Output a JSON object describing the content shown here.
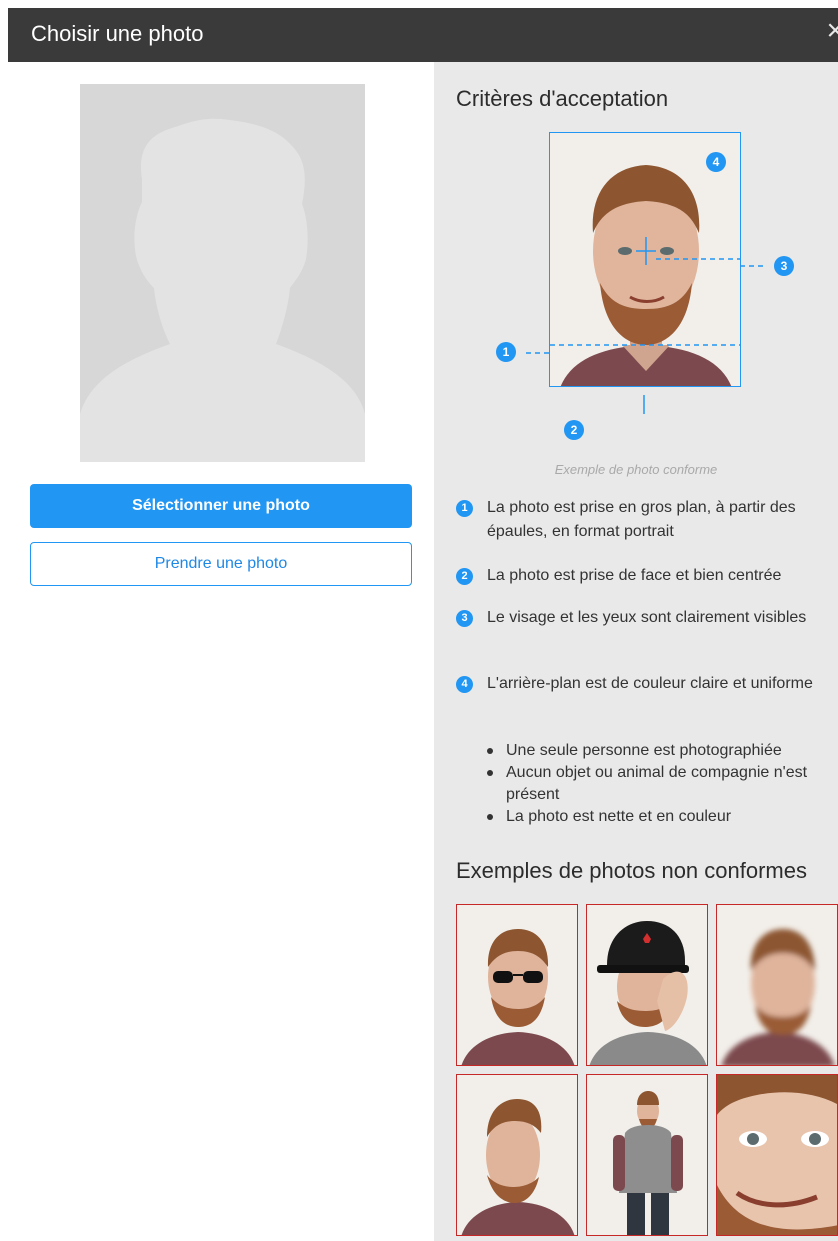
{
  "dialog": {
    "title": "Choisir une photo",
    "close_symbol": "×"
  },
  "left": {
    "avatar_icon": "person-silhouette-icon",
    "select_button": "Sélectionner une photo",
    "take_button": "Prendre une photo"
  },
  "right": {
    "heading": "Critères d'acceptation",
    "markers": [
      "1",
      "2",
      "3",
      "4"
    ],
    "caption": "Exemple de photo conforme",
    "criteria": [
      {
        "num": "1",
        "text": "La photo est prise en gros plan, à partir des épaules, en format portrait"
      },
      {
        "num": "2",
        "text": "La photo est prise de face et bien centrée"
      },
      {
        "num": "3",
        "text": "Le visage et les yeux sont clairement visibles"
      },
      {
        "num": "4",
        "text": "L'arrière-plan est de couleur claire et uniforme"
      }
    ],
    "bullets": [
      "Une seule personne est photographiée",
      "Aucun objet ou animal de compagnie n'est présent",
      "La photo est nette et en couleur"
    ],
    "nonconform_heading": "Exemples de photos non conformes"
  },
  "colors": {
    "accent": "#2196f3",
    "titlebar": "#3a3a3a",
    "panel": "#e9e9e9",
    "reject_border": "#c62828"
  }
}
